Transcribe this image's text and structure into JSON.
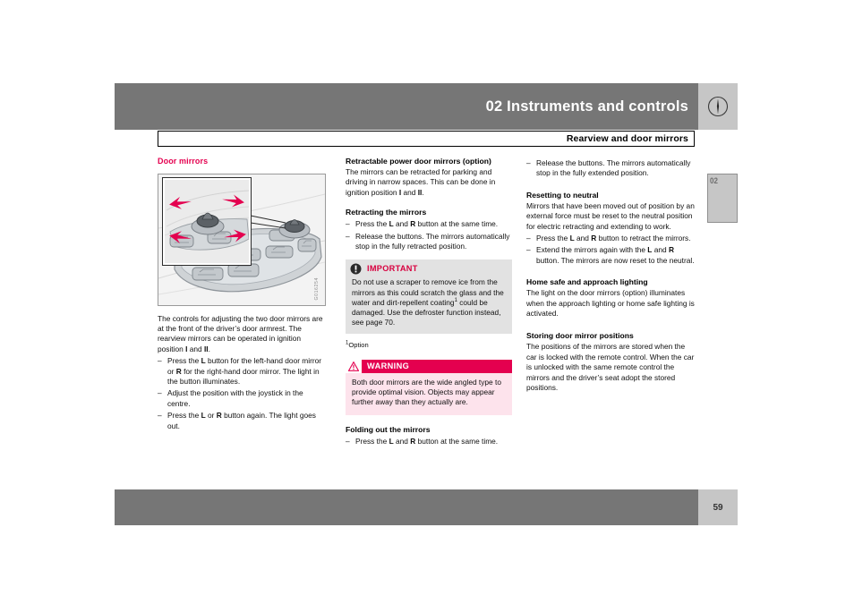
{
  "header": {
    "title": "02 Instruments and controls",
    "icon": "instrument-dial-icon",
    "chapter_number": "02"
  },
  "section": {
    "title": "Rearview and door mirrors"
  },
  "footer": {
    "page_number": "59"
  },
  "column1": {
    "heading": "Door mirrors",
    "figure": {
      "alt": "door armrest mirror controls with joystick",
      "code": "G016254"
    },
    "intro": "The controls for adjusting the two door mirrors are at the front of the driver’s door armrest. The rearview mirrors can be operated in ignition position <b>I</b> and <b>II</b>.",
    "steps": [
      "Press the <b>L</b> button for the left-hand door mirror or <b>R</b> for the right-hand door mirror. The light in the button illuminates.",
      "Adjust the position with the joystick in the centre.",
      "Press the <b>L</b> or <b>R</b> button again. The light goes out."
    ]
  },
  "column2": {
    "heading1": "Retractable power door mirrors (option)",
    "para1": "The mirrors can be retracted for parking and driving in narrow spaces. This can be done in ignition position <b>I</b> and <b>II</b>.",
    "heading2": "Retracting the mirrors",
    "steps2": [
      "Press the <b>L</b> and <b>R</b> button at the same time.",
      "Release the buttons. The mirrors automatically stop in the fully retracted position."
    ],
    "important": {
      "label": "IMPORTANT",
      "icon": "exclamation-circle-icon",
      "body": "Do not use a scraper to remove ice from the mirrors as this could scratch the glass and the water and dirt-repellent coating<sup class=\"sup\">1</sup> could be damaged. Use the defroster function instead, see page 70."
    },
    "footnote": "Option",
    "footnote_marker": "1",
    "warning": {
      "label": "WARNING",
      "icon": "warning-triangle-icon",
      "body": "Both door mirrors are the wide angled type to provide optimal vision. Objects may appear further away than they actually are."
    },
    "heading3": "Folding out the mirrors",
    "steps3": [
      "Press the <b>L</b> and <b>R</b> button at the same time."
    ]
  },
  "column3": {
    "steps_top": [
      "Release the buttons. The mirrors automatically stop in the fully extended position."
    ],
    "heading1": "Resetting to neutral",
    "para1": "Mirrors that have been moved out of position by an external force must be reset to the neutral position for electric retracting and extending to work.",
    "steps1": [
      "Press the <b>L</b> and <b>R</b> button to retract the mirrors.",
      "Extend the mirrors again with the <b>L</b> and <b>R</b> button. The mirrors are now reset to the neutral."
    ],
    "heading2": "Home safe and approach lighting",
    "para2": "The light on the door mirrors (option) illuminates when the approach lighting or home safe lighting is activated.",
    "heading3": "Storing door mirror positions",
    "para3": "The positions of the mirrors are stored when the car is locked with the remote control. When the car is unlocked with the same remote control the mirrors and the driver’s seat adopt the stored positions."
  }
}
